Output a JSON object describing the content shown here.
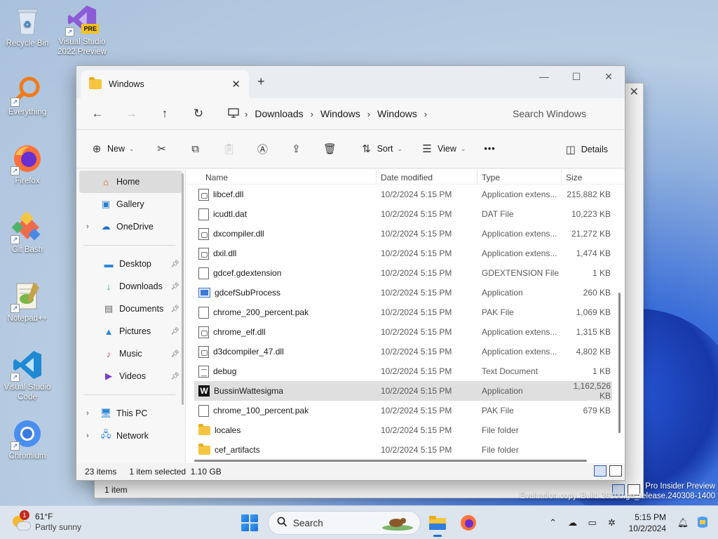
{
  "desktop": {
    "icons": [
      {
        "label": "Recycle Bin",
        "icon": "recycle-bin-icon"
      },
      {
        "label": "Visual Studio 2022 Preview",
        "icon": "visual-studio-preview-icon",
        "badge": "PRE"
      },
      {
        "label": "Everything",
        "icon": "everything-search-icon"
      },
      {
        "label": "Firefox",
        "icon": "firefox-icon"
      },
      {
        "label": "Git Bash",
        "icon": "git-bash-icon"
      },
      {
        "label": "Notepad++",
        "icon": "notepadpp-icon"
      },
      {
        "label": "Visual Studio Code",
        "icon": "vscode-icon"
      },
      {
        "label": "Chromium",
        "icon": "chromium-icon"
      }
    ],
    "watermark_line1": "Pro Insider Preview",
    "watermark_line2": "Evaluation copy. Build 26100.ge_release.240308-1400"
  },
  "back_window": {
    "status": "1 item"
  },
  "explorer": {
    "tab_title": "Windows",
    "new_tab": "+",
    "controls": {
      "minimize": "—",
      "maximize": "☐",
      "close": "✕"
    },
    "breadcrumb": [
      "Downloads",
      "Windows",
      "Windows"
    ],
    "search_placeholder": "Search Windows",
    "toolbar": {
      "new": "New",
      "sort": "Sort",
      "view": "View",
      "more": "•••",
      "details": "Details"
    },
    "sidebar": {
      "home": "Home",
      "gallery": "Gallery",
      "onedrive": "OneDrive",
      "desktop": "Desktop",
      "downloads": "Downloads",
      "documents": "Documents",
      "pictures": "Pictures",
      "music": "Music",
      "videos": "Videos",
      "thispc": "This PC",
      "network": "Network"
    },
    "columns": {
      "name": "Name",
      "date": "Date modified",
      "type": "Type",
      "size": "Size"
    },
    "files": [
      {
        "name": "libcef.dll",
        "date": "10/2/2024 5:15 PM",
        "type": "Application extens...",
        "size": "215,882 KB",
        "icon": "dll",
        "selected": false
      },
      {
        "name": "icudtl.dat",
        "date": "10/2/2024 5:15 PM",
        "type": "DAT File",
        "size": "10,223 KB",
        "icon": "doc",
        "selected": false
      },
      {
        "name": "dxcompiler.dll",
        "date": "10/2/2024 5:15 PM",
        "type": "Application extens...",
        "size": "21,272 KB",
        "icon": "dll",
        "selected": false
      },
      {
        "name": "dxil.dll",
        "date": "10/2/2024 5:15 PM",
        "type": "Application extens...",
        "size": "1,474 KB",
        "icon": "dll",
        "selected": false
      },
      {
        "name": "gdcef.gdextension",
        "date": "10/2/2024 5:15 PM",
        "type": "GDEXTENSION File",
        "size": "1 KB",
        "icon": "doc",
        "selected": false
      },
      {
        "name": "gdcefSubProcess",
        "date": "10/2/2024 5:15 PM",
        "type": "Application",
        "size": "260 KB",
        "icon": "app",
        "selected": false
      },
      {
        "name": "chrome_200_percent.pak",
        "date": "10/2/2024 5:15 PM",
        "type": "PAK File",
        "size": "1,069 KB",
        "icon": "doc",
        "selected": false
      },
      {
        "name": "chrome_elf.dll",
        "date": "10/2/2024 5:15 PM",
        "type": "Application extens...",
        "size": "1,315 KB",
        "icon": "dll",
        "selected": false
      },
      {
        "name": "d3dcompiler_47.dll",
        "date": "10/2/2024 5:15 PM",
        "type": "Application extens...",
        "size": "4,802 KB",
        "icon": "dll",
        "selected": false
      },
      {
        "name": "debug",
        "date": "10/2/2024 5:15 PM",
        "type": "Text Document",
        "size": "1 KB",
        "icon": "txt",
        "selected": false
      },
      {
        "name": "BussinWattesigma",
        "date": "10/2/2024 5:15 PM",
        "type": "Application",
        "size": "1,162,526 KB",
        "icon": "w",
        "selected": true
      },
      {
        "name": "chrome_100_percent.pak",
        "date": "10/2/2024 5:15 PM",
        "type": "PAK File",
        "size": "679 KB",
        "icon": "doc",
        "selected": false
      },
      {
        "name": "locales",
        "date": "10/2/2024 5:15 PM",
        "type": "File folder",
        "size": "",
        "icon": "folder",
        "selected": false
      },
      {
        "name": "cef_artifacts",
        "date": "10/2/2024 5:15 PM",
        "type": "File folder",
        "size": "",
        "icon": "folder",
        "selected": false
      }
    ],
    "status": {
      "count": "23 items",
      "selected": "1 item selected",
      "size": "1.10 GB"
    }
  },
  "taskbar": {
    "weather_temp": "61°F",
    "weather_cond": "Partly sunny",
    "weather_badge": "1",
    "search_label": "Search",
    "time": "5:15 PM",
    "date": "10/2/2024"
  }
}
